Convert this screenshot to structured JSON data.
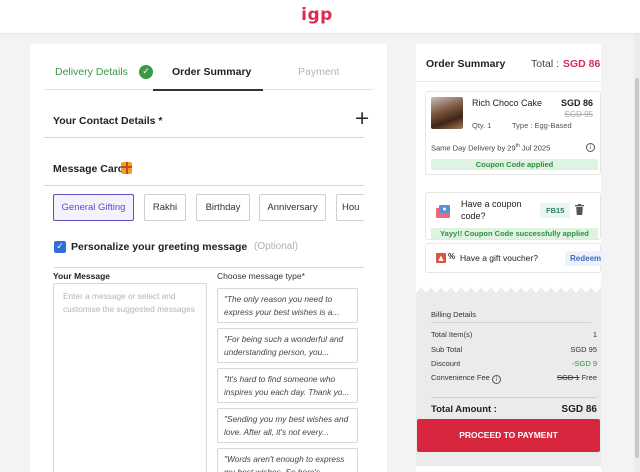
{
  "brand": {
    "logo_text": "igp"
  },
  "checkout_tabs": {
    "delivery": "Delivery Details",
    "summary": "Order Summary",
    "payment": "Payment"
  },
  "contact": {
    "label": "Your Contact Details *"
  },
  "message_card": {
    "label": "Message Card",
    "occasions": [
      {
        "label": "General Gifting",
        "active": true
      },
      {
        "label": "Rakhi",
        "active": false
      },
      {
        "label": "Birthday",
        "active": false
      },
      {
        "label": "Anniversary",
        "active": false
      },
      {
        "label": "Hou",
        "active": false
      }
    ],
    "personalize_label": "Personalize your greeting message",
    "personalize_optional": "(Optional)",
    "personalize_checked": true,
    "your_message_label": "Your Message",
    "textarea_placeholder": "Enter a message or select and customise the suggested messages",
    "choose_type_label": "Choose message type*",
    "suggestions": [
      "\"The only reason you need to express your best wishes is a...",
      "\"For being such a wonderful and understanding person, you...",
      "\"It's hard to find someone who inspires you each day. Thank yo...",
      "\"Sending you my best wishes and love. After all, it's not every...",
      "\"Words aren't enough to express my best wishes. So here's..."
    ]
  },
  "order_summary": {
    "title": "Order Summary",
    "total_label": "Total :",
    "total_value": "SGD 86",
    "product": {
      "name": "Rich Choco Cake",
      "price": "SGD 86",
      "mrp": "SGD 95",
      "qty": "Qty. 1",
      "type": "Type : Egg-Based",
      "delivery_prefix": "Same Day Delivery by 29",
      "delivery_sup": "th",
      "delivery_suffix": " Jul 2025",
      "coupon_status": "Coupon Code applied"
    },
    "coupon": {
      "prompt": "Have a coupon code?",
      "code": "FB15",
      "success": "Yayy!! Coupon Code successfully applied"
    },
    "voucher": {
      "pct": "%",
      "prompt": "Have a gift voucher?",
      "button": "Redeem"
    },
    "billing": {
      "title": "Billing Details",
      "rows": [
        {
          "label": "Total Item(s)",
          "value": "1"
        },
        {
          "label": "Sub Total",
          "value": "SGD 95"
        },
        {
          "label": "Discount",
          "value": "-SGD 9"
        },
        {
          "label": "Convenience Fee",
          "value_struck": "SGD 1",
          "value": "Free"
        }
      ],
      "total_amount_label": "Total Amount :",
      "total_amount_value": "SGD 86"
    },
    "proceed_button": "PROCEED TO PAYMENT"
  },
  "colors": {
    "brand": "#d92b53",
    "success": "#3a9b45",
    "accent_purple": "#5e4ec0",
    "cta": "#d9263f"
  },
  "icons": [
    "check-circle-icon",
    "plus-icon",
    "gift-icon",
    "checkbox-icon",
    "info-icon",
    "coupon-icon",
    "trash-icon",
    "voucher-icon"
  ]
}
